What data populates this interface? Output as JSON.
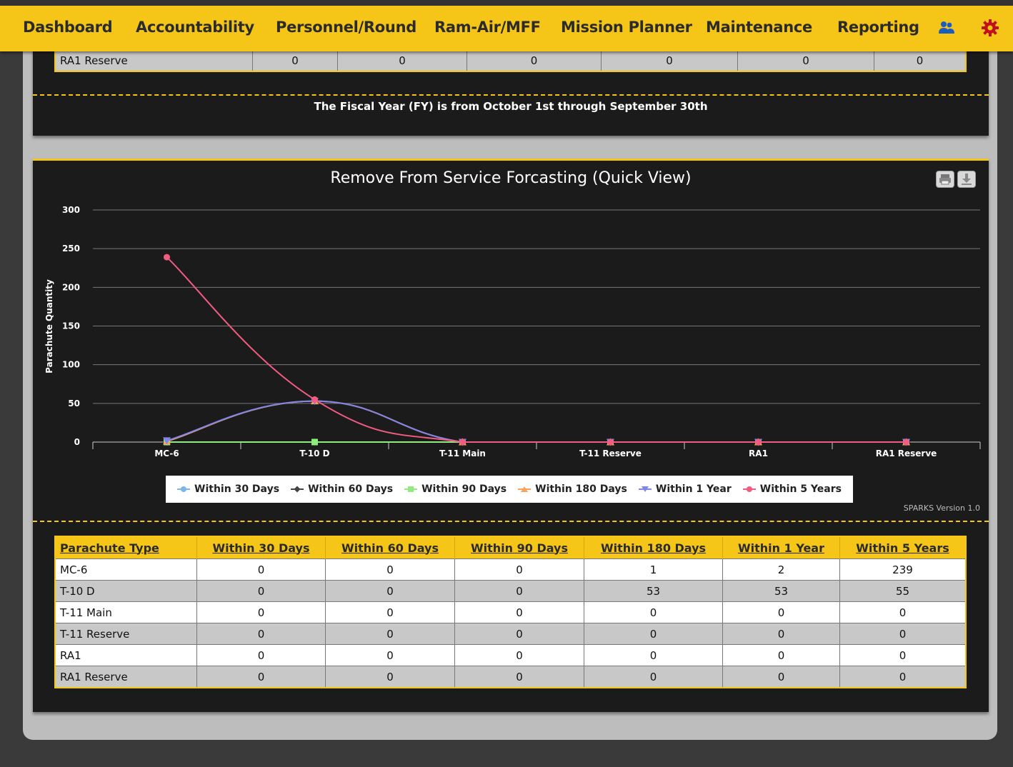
{
  "nav": {
    "items": [
      "Dashboard",
      "Accountability",
      "Personnel/Round",
      "Ram-Air/MFF",
      "Mission Planner",
      "Maintenance",
      "Reporting"
    ],
    "users_icon": "users-icon",
    "settings_icon": "gear-icon"
  },
  "top_table": {
    "row": [
      "RA1 Reserve",
      "0",
      "0",
      "0",
      "0",
      "0",
      "0"
    ]
  },
  "fy_note": "The Fiscal Year (FY) is from October 1st through September 30th",
  "chart_panel": {
    "title": "Remove From Service Forcasting (Quick View)",
    "print_icon": "print-icon",
    "download_icon": "download-icon",
    "version": "SPARKS Version 1.0"
  },
  "chart_data": {
    "type": "line",
    "title": "Remove From Service Forcasting (Quick View)",
    "xlabel": "",
    "ylabel": "Parachute Quantity",
    "ylim": [
      0,
      300
    ],
    "yticks": [
      0,
      50,
      100,
      150,
      200,
      250,
      300
    ],
    "categories": [
      "MC-6",
      "T-10 D",
      "T-11 Main",
      "T-11 Reserve",
      "RA1",
      "RA1 Reserve"
    ],
    "grid": true,
    "legend": "bottom",
    "series": [
      {
        "name": "Within 30 Days",
        "color": "#7cb5ec",
        "marker": "circle",
        "values": [
          0,
          0,
          0,
          0,
          0,
          0
        ]
      },
      {
        "name": "Within 60 Days",
        "color": "#434348",
        "marker": "diamond",
        "values": [
          0,
          0,
          0,
          0,
          0,
          0
        ]
      },
      {
        "name": "Within 90 Days",
        "color": "#90ed7d",
        "marker": "square",
        "values": [
          0,
          0,
          0,
          0,
          0,
          0
        ]
      },
      {
        "name": "Within 180 Days",
        "color": "#f7a35c",
        "marker": "triangle",
        "values": [
          1,
          53,
          0,
          0,
          0,
          0
        ]
      },
      {
        "name": "Within 1 Year",
        "color": "#8085e9",
        "marker": "triangle-down",
        "values": [
          2,
          53,
          0,
          0,
          0,
          0
        ]
      },
      {
        "name": "Within 5 Years",
        "color": "#f15c80",
        "marker": "circle",
        "values": [
          239,
          55,
          0,
          0,
          0,
          0
        ]
      }
    ]
  },
  "table": {
    "headers": [
      "Parachute Type",
      "Within 30 Days",
      "Within 60 Days",
      "Within 90 Days",
      "Within 180 Days",
      "Within 1 Year",
      "Within 5 Years"
    ],
    "rows": [
      [
        "MC-6",
        "0",
        "0",
        "0",
        "1",
        "2",
        "239"
      ],
      [
        "T-10 D",
        "0",
        "0",
        "0",
        "53",
        "53",
        "55"
      ],
      [
        "T-11 Main",
        "0",
        "0",
        "0",
        "0",
        "0",
        "0"
      ],
      [
        "T-11 Reserve",
        "0",
        "0",
        "0",
        "0",
        "0",
        "0"
      ],
      [
        "RA1",
        "0",
        "0",
        "0",
        "0",
        "0",
        "0"
      ],
      [
        "RA1 Reserve",
        "0",
        "0",
        "0",
        "0",
        "0",
        "0"
      ]
    ]
  }
}
